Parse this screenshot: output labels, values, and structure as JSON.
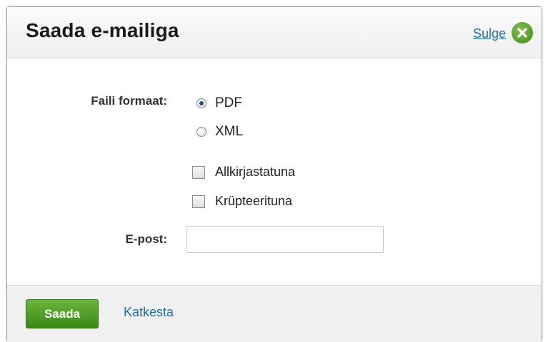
{
  "dialog": {
    "title": "Saada e-mailiga",
    "close_label": "Sulge",
    "close_icon": "close-icon",
    "accent_color": "#4a9a22",
    "link_color": "#1f6fa8"
  },
  "form": {
    "format_label": "Faili formaat:",
    "format_options": [
      {
        "label": "PDF",
        "checked": true
      },
      {
        "label": "XML",
        "checked": false
      }
    ],
    "signed_label": "Allkirjastatuna",
    "signed_checked": false,
    "encrypted_label": "Krüpteerituna",
    "encrypted_checked": false,
    "email_label": "E-post:",
    "email_value": ""
  },
  "footer": {
    "send_label": "Saada",
    "cancel_label": "Katkesta"
  }
}
